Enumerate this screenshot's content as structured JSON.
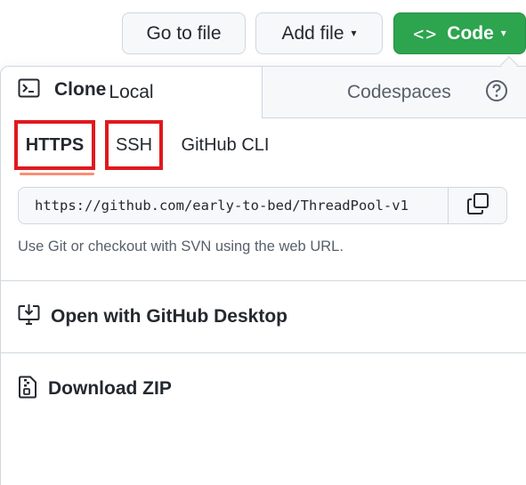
{
  "toolbar": {
    "goto_label": "Go to file",
    "add_label": "Add file",
    "code_label": "Code",
    "code_icon": "<>",
    "caret": "▾"
  },
  "tabs": {
    "local": "Local",
    "codespaces": "Codespaces"
  },
  "clone": {
    "title": "Clone",
    "protocols": [
      "HTTPS",
      "SSH",
      "GitHub CLI"
    ],
    "selected": "HTTPS",
    "url": "https://github.com/early-to-bed/ThreadPool-v1",
    "hint": "Use Git or checkout with SVN using the web URL."
  },
  "actions": {
    "desktop": "Open with GitHub Desktop",
    "zip": "Download ZIP"
  },
  "colors": {
    "code_button": "#2da44e",
    "highlight_box": "#e0191e",
    "tab_underline": "#fd8c73"
  },
  "icons": [
    "terminal-icon",
    "question-circle-icon",
    "copy-icon",
    "desktop-download-icon",
    "file-zip-icon"
  ]
}
